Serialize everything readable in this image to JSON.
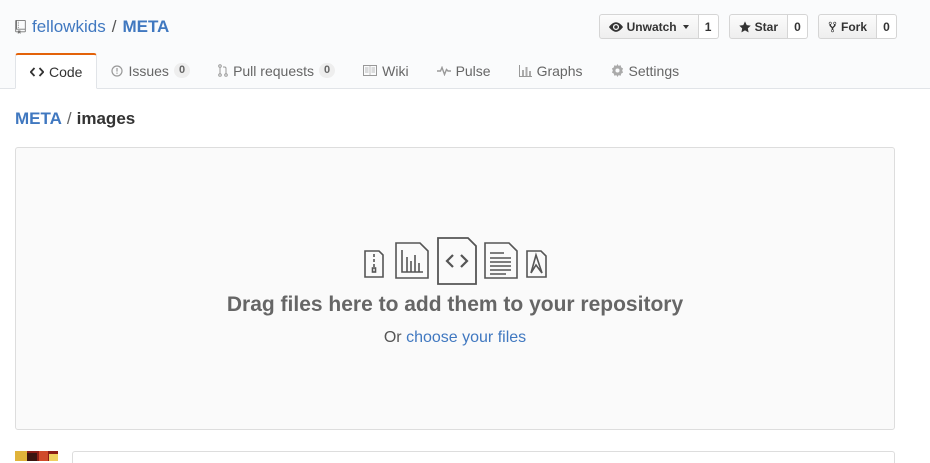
{
  "repo": {
    "owner": "fellowkids",
    "separator": "/",
    "name": "META"
  },
  "actions": {
    "unwatch": {
      "label": "Unwatch",
      "count": "1"
    },
    "star": {
      "label": "Star",
      "count": "0"
    },
    "fork": {
      "label": "Fork",
      "count": "0"
    }
  },
  "tabs": [
    {
      "label": "Code",
      "icon": "code-icon",
      "selected": true
    },
    {
      "label": "Issues",
      "count": "0",
      "icon": "issue-icon"
    },
    {
      "label": "Pull requests",
      "count": "0",
      "icon": "pull-request-icon"
    },
    {
      "label": "Wiki",
      "icon": "book-icon"
    },
    {
      "label": "Pulse",
      "icon": "pulse-icon"
    },
    {
      "label": "Graphs",
      "icon": "graph-icon"
    },
    {
      "label": "Settings",
      "icon": "gear-icon"
    }
  ],
  "breadcrumb": {
    "root": "META",
    "separator": "/",
    "current": "images"
  },
  "dropzone": {
    "title": "Drag files here to add them to your repository",
    "prefix": "Or",
    "link": "choose your files",
    "icons": [
      "zip-file-icon",
      "chart-file-icon",
      "code-file-icon",
      "text-file-icon",
      "pdf-file-icon"
    ]
  },
  "colors": {
    "link": "#4078c0",
    "selected_tab_accent": "#e36209",
    "text": "#333333"
  }
}
